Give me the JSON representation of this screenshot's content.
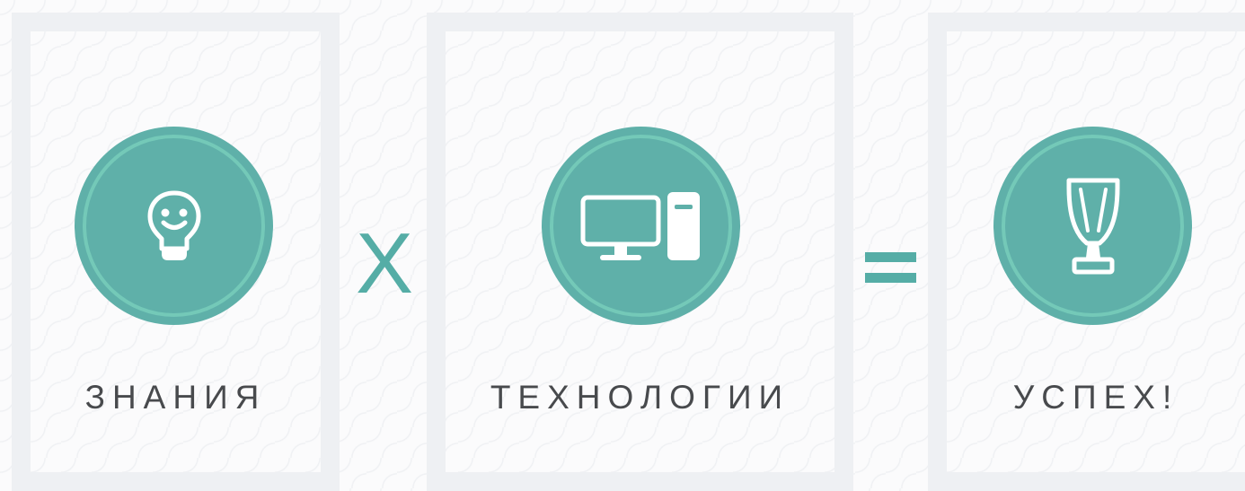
{
  "colors": {
    "accent": "#5fb0a9",
    "ring": "#74c9b8",
    "card_border": "#eef0f3",
    "label_text": "#484a4d",
    "operator": "#55ada6"
  },
  "cards": [
    {
      "label": "ЗНАНИЯ",
      "icon": "smiling-lightbulb-icon"
    },
    {
      "label": "ТЕХНОЛОГИИ",
      "icon": "desktop-computer-icon"
    },
    {
      "label": "УСПЕХ!",
      "icon": "trophy-cup-icon"
    }
  ],
  "operators": {
    "multiply": "X",
    "equals": "="
  }
}
